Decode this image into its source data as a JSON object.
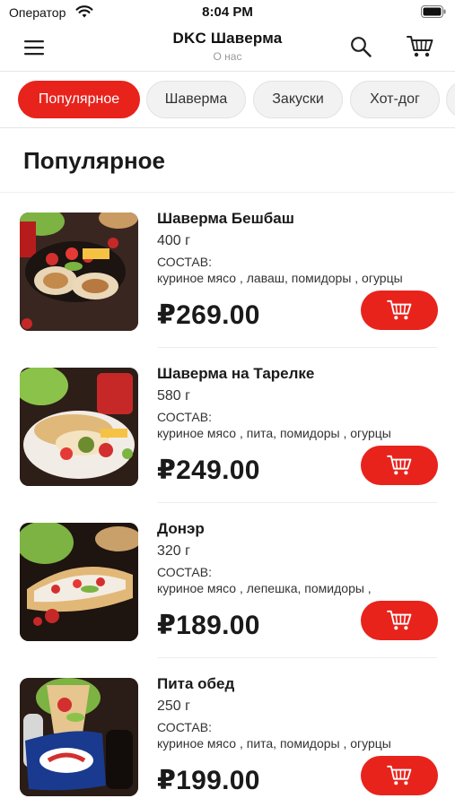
{
  "status_bar": {
    "carrier": "Оператор",
    "time": "8:04 PM"
  },
  "header": {
    "title": "DKC Шаверма",
    "subtitle": "О нас",
    "menu_icon": "hamburger-menu-icon",
    "search_icon": "search-icon",
    "cart_icon": "cart-icon"
  },
  "tabs": [
    {
      "label": "Популярное",
      "active": true
    },
    {
      "label": "Шаверма",
      "active": false
    },
    {
      "label": "Закуски",
      "active": false
    },
    {
      "label": "Хот-дог",
      "active": false
    },
    {
      "label": "",
      "active": false
    }
  ],
  "section": {
    "title": "Популярное"
  },
  "products": [
    {
      "name": "Шаверма Бешбаш",
      "weight": "400 г",
      "composition_label": "СОСТАВ:",
      "composition": "куриное мясо , лаваш, помидоры , огурцы",
      "price": "₽269.00"
    },
    {
      "name": "Шаверма на Тарелке",
      "weight": "580 г",
      "composition_label": "СОСТАВ:",
      "composition": "куриное мясо , пита, помидоры , огурцы",
      "price": "₽249.00"
    },
    {
      "name": "Донэр",
      "weight": "320 г",
      "composition_label": "СОСТАВ:",
      "composition": "куриное мясо , лепешка, помидоры ,",
      "price": "₽189.00"
    },
    {
      "name": "Пита обед",
      "weight": "250 г",
      "composition_label": "СОСТАВ:",
      "composition": "куриное мясо , пита, помидоры , огурцы",
      "price": "₽199.00"
    }
  ],
  "colors": {
    "accent": "#e8231c",
    "tab_inactive": "#f2f2f2",
    "text": "#1a1a1a",
    "muted": "#9a9a9a"
  }
}
